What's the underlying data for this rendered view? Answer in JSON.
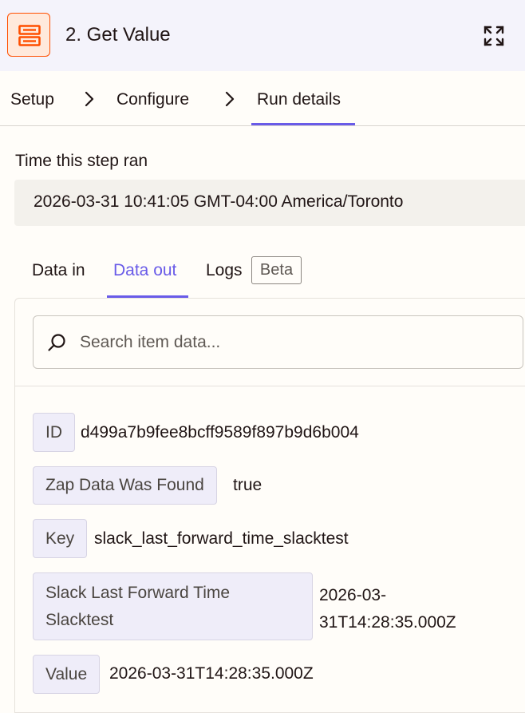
{
  "header": {
    "step_title": "2. Get Value",
    "app_icon": "storage-icon",
    "expand_icon": "expand-icon",
    "accent": "#ff4f00"
  },
  "breadcrumb": {
    "items": [
      "Setup",
      "Configure",
      "Run details"
    ],
    "active": "Run details",
    "separator_icon": "chevron-right-icon"
  },
  "run": {
    "time_label": "Time this step ran",
    "time_value": "2026-03-31 10:41:05 GMT-04:00 America/Toronto"
  },
  "data_tabs": {
    "items": [
      "Data in",
      "Data out",
      "Logs"
    ],
    "active": "Data out",
    "badge": "Beta",
    "accent": "#695be8"
  },
  "search": {
    "placeholder": "Search item data...",
    "value": "",
    "icon": "search-icon"
  },
  "fields": [
    {
      "key": "ID",
      "value": "d499a7b9fee8bcff9589f897b9d6b004"
    },
    {
      "key": "Zap Data Was Found",
      "value": "true"
    },
    {
      "key": "Key",
      "value": "slack_last_forward_time_slacktest"
    },
    {
      "key_lines": [
        "Slack Last Forward Time",
        "Slacktest"
      ],
      "value_lines": [
        "2026-03-",
        "31T14:28:35.000Z"
      ]
    },
    {
      "key": "Value",
      "value": "2026-03-31T14:28:35.000Z"
    }
  ]
}
